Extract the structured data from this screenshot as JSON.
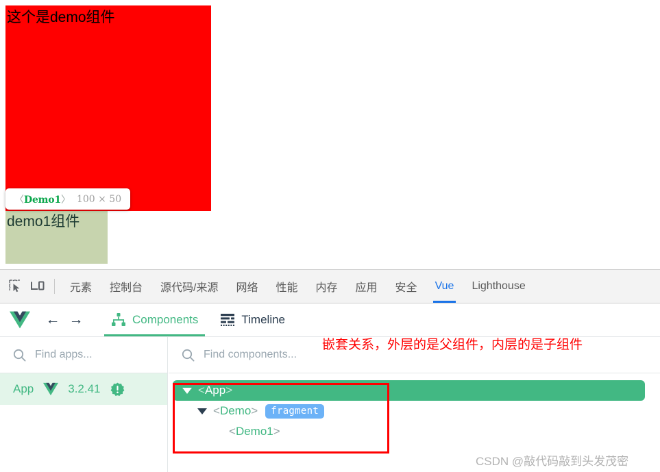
{
  "page": {
    "demo_component_label": "这个是demo组件",
    "demo1_component_label": "demo1组件",
    "red_box_color": "#ff0000",
    "green_box_color": "#c7d4ae"
  },
  "inspect_tooltip": {
    "open_bracket": "〈",
    "tag_name": "Demo1",
    "close_bracket": "〉",
    "dimensions": "100 × 50"
  },
  "devtools": {
    "icons": {
      "inspect": "inspect-element-icon",
      "device": "device-toolbar-icon"
    },
    "tabs": [
      {
        "label": "元素",
        "active": false
      },
      {
        "label": "控制台",
        "active": false
      },
      {
        "label": "源代码/来源",
        "active": false
      },
      {
        "label": "网络",
        "active": false
      },
      {
        "label": "性能",
        "active": false
      },
      {
        "label": "内存",
        "active": false
      },
      {
        "label": "应用",
        "active": false
      },
      {
        "label": "安全",
        "active": false
      },
      {
        "label": "Vue",
        "active": true
      },
      {
        "label": "Lighthouse",
        "active": false
      }
    ],
    "active_tab": "Vue",
    "active_tab_color": "#1a73e8"
  },
  "vue_toolbar": {
    "logo": "vue-logo-icon",
    "back_arrow": "←",
    "forward_arrow": "→",
    "tabs": [
      {
        "label": "Components",
        "icon": "component-tree-icon",
        "active": true
      },
      {
        "label": "Timeline",
        "icon": "timeline-icon",
        "active": false
      }
    ],
    "accent_color": "#42b883"
  },
  "apps_panel": {
    "search_placeholder": "Find apps...",
    "search_value": "",
    "app": {
      "name": "App",
      "version": "3.2.41",
      "badge": "warning-badge-icon",
      "selected": true
    }
  },
  "components_panel": {
    "search_placeholder": "Find components...",
    "search_value": "",
    "tree": [
      {
        "tag": "App",
        "expanded": true,
        "has_caret": true,
        "selected": true,
        "depth": 0,
        "badge": null
      },
      {
        "tag": "Demo",
        "expanded": true,
        "has_caret": true,
        "selected": false,
        "depth": 1,
        "badge": "fragment"
      },
      {
        "tag": "Demo1",
        "expanded": false,
        "has_caret": false,
        "selected": false,
        "depth": 2,
        "badge": null
      }
    ],
    "open_bracket": "<",
    "close_bracket": ">"
  },
  "annotations": {
    "red_note": "嵌套关系，外层的是父组件，内层的是子组件",
    "red_color": "#ff0000",
    "watermark": "CSDN @敲代码敲到头发茂密"
  }
}
